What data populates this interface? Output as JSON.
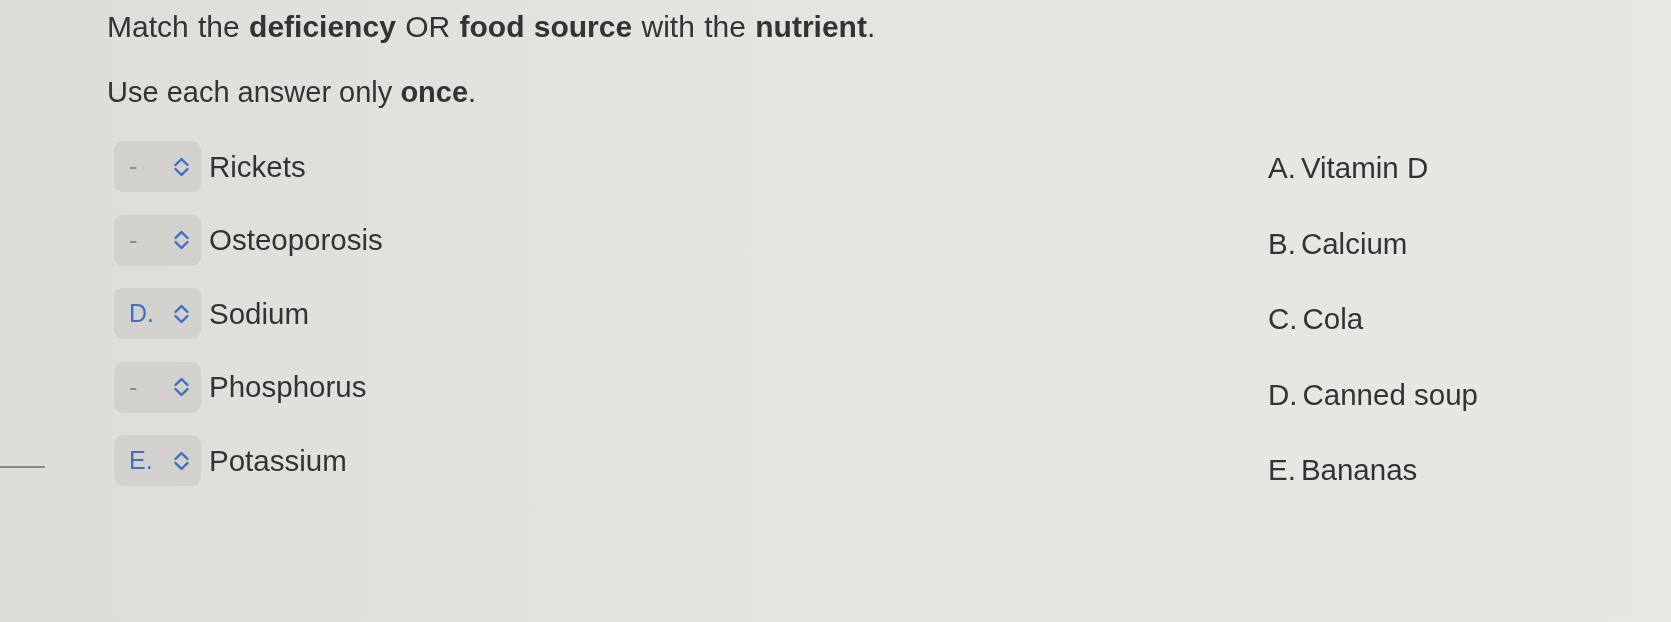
{
  "question": {
    "prompt": "Match the **deficiency** OR **food source** with the **nutrient**.",
    "instruction": "Use each answer only **once**."
  },
  "items": [
    {
      "answer": "-",
      "answered": false,
      "label": "Rickets"
    },
    {
      "answer": "-",
      "answered": false,
      "label": "Osteoporosis"
    },
    {
      "answer": "D.",
      "answered": true,
      "label": "Sodium"
    },
    {
      "answer": "-",
      "answered": false,
      "label": "Phosphorus"
    },
    {
      "answer": "E.",
      "answered": true,
      "label": "Potassium"
    }
  ],
  "options": [
    {
      "letter": "A.",
      "text": "Vitamin D"
    },
    {
      "letter": "B.",
      "text": "Calcium"
    },
    {
      "letter": "C.",
      "text": "Cola"
    },
    {
      "letter": "D.",
      "text": "Canned soup"
    },
    {
      "letter": "E.",
      "text": "Bananas"
    }
  ]
}
